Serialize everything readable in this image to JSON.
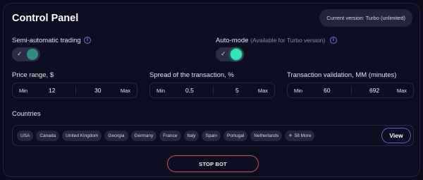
{
  "header": {
    "title": "Control Panel",
    "version_badge": "Current version: Turbo (unlimited)"
  },
  "semi_auto": {
    "label": "Semi-automatic trading",
    "enabled": true,
    "check": "✓",
    "info_icon": "i"
  },
  "auto_mode": {
    "label": "Auto-mode",
    "note": "(Available for Turbo version)",
    "enabled": true,
    "check": "✓",
    "info_icon": "i"
  },
  "price_range": {
    "label": "Price range, $",
    "min_label": "Min",
    "min_value": "12",
    "max_value": "30",
    "max_label": "Max"
  },
  "spread": {
    "label": "Spread of the transaction, %",
    "min_label": "Min",
    "min_value": "0,5",
    "max_value": "5",
    "max_label": "Max"
  },
  "validation": {
    "label": "Transaction validation, MM (minutes)",
    "min_label": "Min",
    "min_value": "60",
    "max_value": "692",
    "max_label": "Max"
  },
  "countries": {
    "label": "Countries",
    "items": [
      "USA",
      "Canada",
      "United Kingdom",
      "Georgia",
      "Germany",
      "France",
      "Italy",
      "Spain",
      "Portugal",
      "Netherlands"
    ],
    "more_icon": "+",
    "more_label": "58 More",
    "view_label": "View"
  },
  "actions": {
    "stop_label": "STOP BOT"
  },
  "colors": {
    "accent_green": "#33e6b4",
    "accent_blue": "#5c66c8",
    "danger": "#c94a60"
  }
}
